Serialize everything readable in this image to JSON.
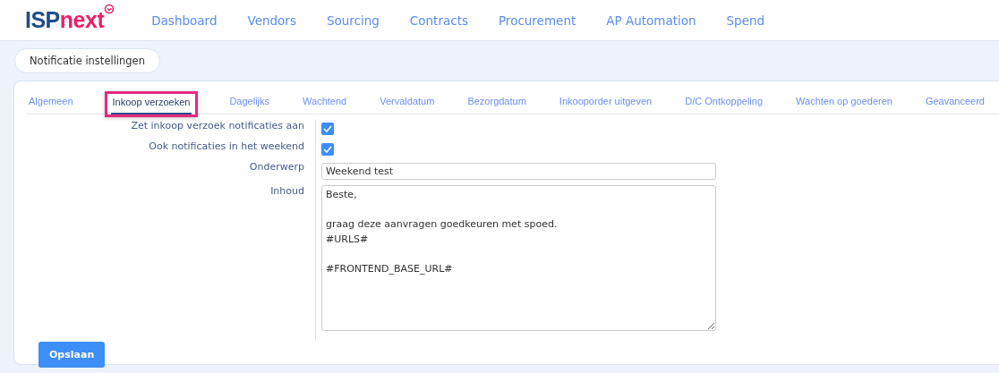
{
  "header": {
    "logo": {
      "part_1": "ISP",
      "part_2": "next"
    },
    "nav": [
      "Dashboard",
      "Vendors",
      "Sourcing",
      "Contracts",
      "Procurement",
      "AP Automation",
      "Spend"
    ]
  },
  "page_button": "Notificatie instellingen",
  "tabs": [
    {
      "label": "Algemeen",
      "selected": false
    },
    {
      "label": "Inkoop verzoeken",
      "selected": true,
      "highlighted": true
    },
    {
      "label": "Dagelijks",
      "selected": false
    },
    {
      "label": "Wachtend",
      "selected": false
    },
    {
      "label": "Vervaldatum",
      "selected": false
    },
    {
      "label": "Bezorgdatum",
      "selected": false
    },
    {
      "label": "Inkooporder uitgeven",
      "selected": false
    },
    {
      "label": "D/C Ontkoppeling",
      "selected": false
    },
    {
      "label": "Wachten op goederen",
      "selected": false
    },
    {
      "label": "Geavanceerd",
      "selected": false
    }
  ],
  "form": [
    {
      "kind": "checkbox",
      "label": "Zet inkoop verzoek notificaties aan",
      "checked": true
    },
    {
      "kind": "checkbox",
      "label": "Ook notificaties in het weekend",
      "checked": true
    },
    {
      "kind": "text",
      "label": "Onderwerp",
      "value": "Weekend test"
    },
    {
      "kind": "textarea",
      "label": "Inhoud",
      "value": "Beste,\n\ngraag deze aanvragen goedkeuren met spoed.\n#URLS#\n\n#FRONTEND_BASE_URL#"
    }
  ],
  "save_button": "Opslaan"
}
